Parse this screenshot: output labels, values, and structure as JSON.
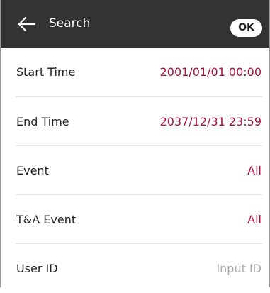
{
  "header": {
    "title": "Search",
    "ok_label": "OK"
  },
  "fields": [
    {
      "label": "Start Time",
      "value": "2001/01/01 00:00"
    },
    {
      "label": "End Time",
      "value": "2037/12/31 23:59"
    },
    {
      "label": "Event",
      "value": "All"
    },
    {
      "label": "T&A Event",
      "value": "All"
    },
    {
      "label": "User ID",
      "placeholder": "Input ID"
    }
  ],
  "colors": {
    "header_bg": "#333333",
    "accent": "#a4123f",
    "placeholder": "#aaaaaa"
  },
  "icons": {
    "back": "arrow-left-icon"
  }
}
